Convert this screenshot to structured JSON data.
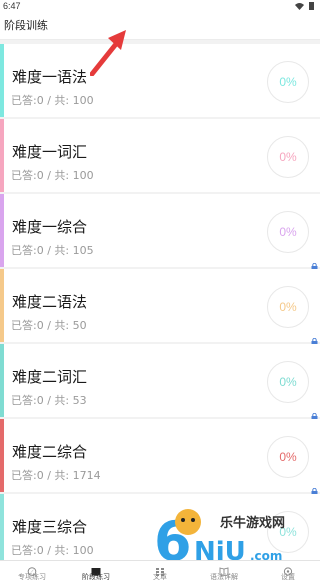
{
  "status_bar": {
    "time": "6:47"
  },
  "header": {
    "title": "阶段训练"
  },
  "cards": [
    {
      "title": "难度一语法",
      "answered_label": "已答:0 / 共: 100",
      "percent": "0%",
      "accent": "#7ee8e0",
      "locked": false
    },
    {
      "title": "难度一词汇",
      "answered_label": "已答:0 / 共: 100",
      "percent": "0%",
      "accent": "#f6a6bf",
      "locked": false
    },
    {
      "title": "难度一综合",
      "answered_label": "已答:0 / 共: 105",
      "percent": "0%",
      "accent": "#d9a5ee",
      "locked": true
    },
    {
      "title": "难度二语法",
      "answered_label": "已答:0 / 共: 50",
      "percent": "0%",
      "accent": "#f5c98a",
      "locked": true
    },
    {
      "title": "难度二词汇",
      "answered_label": "已答:0 / 共: 53",
      "percent": "0%",
      "accent": "#7fdcd2",
      "locked": true
    },
    {
      "title": "难度二综合",
      "answered_label": "已答:0 / 共: 1714",
      "percent": "0%",
      "accent": "#e46a6a",
      "locked": true
    },
    {
      "title": "难度三综合",
      "answered_label": "已答:0 / 共: 100",
      "percent": "0%",
      "accent": "#8fe3dc",
      "locked": true
    }
  ],
  "tabs": [
    {
      "label": "专项练习",
      "icon": "compass-icon",
      "active": false
    },
    {
      "label": "阶段练习",
      "icon": "folder-icon",
      "active": true
    },
    {
      "label": "文章",
      "icon": "grid-icon",
      "active": false
    },
    {
      "label": "语法详解",
      "icon": "book-icon",
      "active": false
    },
    {
      "label": "设置",
      "icon": "gear-icon",
      "active": false
    }
  ],
  "watermark": {
    "text": "乐牛游戏网",
    "logo_text": "6NiU.com"
  },
  "colors": {
    "lock": "#4a7fd6",
    "arrow": "#e53b3b"
  }
}
